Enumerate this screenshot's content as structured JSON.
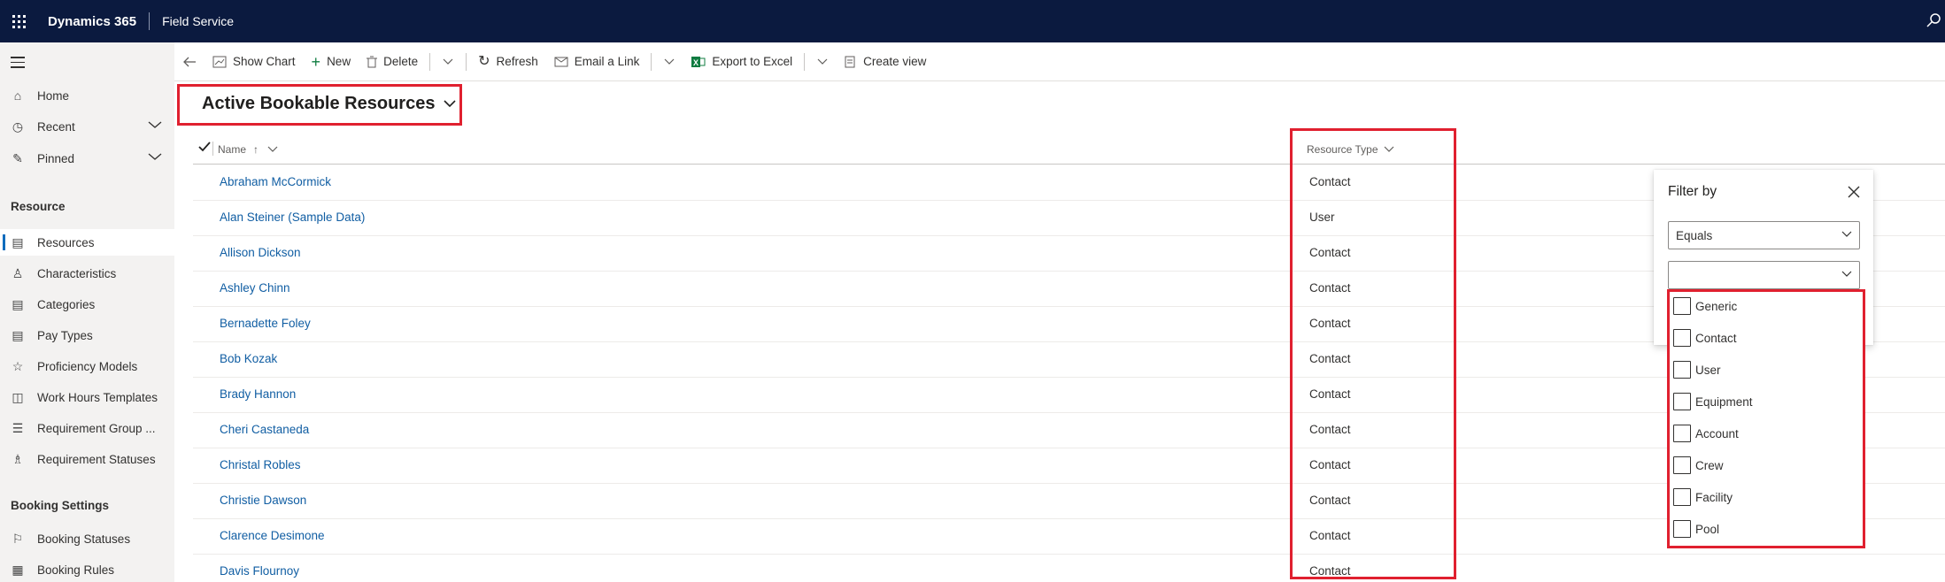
{
  "topbar": {
    "brand": "Dynamics 365",
    "app": "Field Service",
    "icons": [
      "waffle-icon",
      "search-icon"
    ]
  },
  "sidebar": {
    "top_items": [
      {
        "label": "Home",
        "icon": "home-icon"
      },
      {
        "label": "Recent",
        "icon": "clock-icon"
      },
      {
        "label": "Pinned",
        "icon": "pin-icon"
      }
    ],
    "section_resource": "Resource",
    "resource_items": [
      {
        "label": "Resources",
        "icon": "resource-icon"
      },
      {
        "label": "Characteristics",
        "icon": "characteristic-icon"
      },
      {
        "label": "Categories",
        "icon": "category-icon"
      },
      {
        "label": "Pay Types",
        "icon": "paytype-icon"
      },
      {
        "label": "Proficiency Models",
        "icon": "star-icon"
      },
      {
        "label": "Work Hours Templates",
        "icon": "calendar-clock-icon"
      },
      {
        "label": "Requirement Group ...",
        "icon": "list-icon"
      },
      {
        "label": "Requirement Statuses",
        "icon": "people-icon"
      }
    ],
    "section_booking": "Booking Settings",
    "booking_items": [
      {
        "label": "Booking Statuses",
        "icon": "flag-icon"
      },
      {
        "label": "Booking Rules",
        "icon": "table-icon"
      }
    ]
  },
  "commands": {
    "show_chart": "Show Chart",
    "new": "New",
    "delete": "Delete",
    "refresh": "Refresh",
    "email_link": "Email a Link",
    "export_excel": "Export to Excel",
    "create_view": "Create view"
  },
  "view": {
    "title": "Active Bookable Resources"
  },
  "grid": {
    "columns": {
      "name": "Name",
      "name_sort": "↑",
      "resource_type": "Resource Type"
    },
    "rows": [
      {
        "name": "Abraham McCormick",
        "type": "Contact"
      },
      {
        "name": "Alan Steiner (Sample Data)",
        "type": "User"
      },
      {
        "name": "Allison Dickson",
        "type": "Contact"
      },
      {
        "name": "Ashley Chinn",
        "type": "Contact"
      },
      {
        "name": "Bernadette Foley",
        "type": "Contact"
      },
      {
        "name": "Bob Kozak",
        "type": "Contact"
      },
      {
        "name": "Brady Hannon",
        "type": "Contact"
      },
      {
        "name": "Cheri Castaneda",
        "type": "Contact"
      },
      {
        "name": "Christal Robles",
        "type": "Contact"
      },
      {
        "name": "Christie Dawson",
        "type": "Contact"
      },
      {
        "name": "Clarence Desimone",
        "type": "Contact"
      },
      {
        "name": "Davis Flournoy",
        "type": "Contact"
      }
    ]
  },
  "filter": {
    "title": "Filter by",
    "operator": "Equals",
    "input_value": "",
    "options": [
      "Generic",
      "Contact",
      "User",
      "Equipment",
      "Account",
      "Crew",
      "Facility",
      "Pool"
    ]
  },
  "colors": {
    "topbar": "#0b1a3f",
    "link": "#115ea3",
    "highlight": "#e0202f",
    "excel": "#107c41"
  }
}
